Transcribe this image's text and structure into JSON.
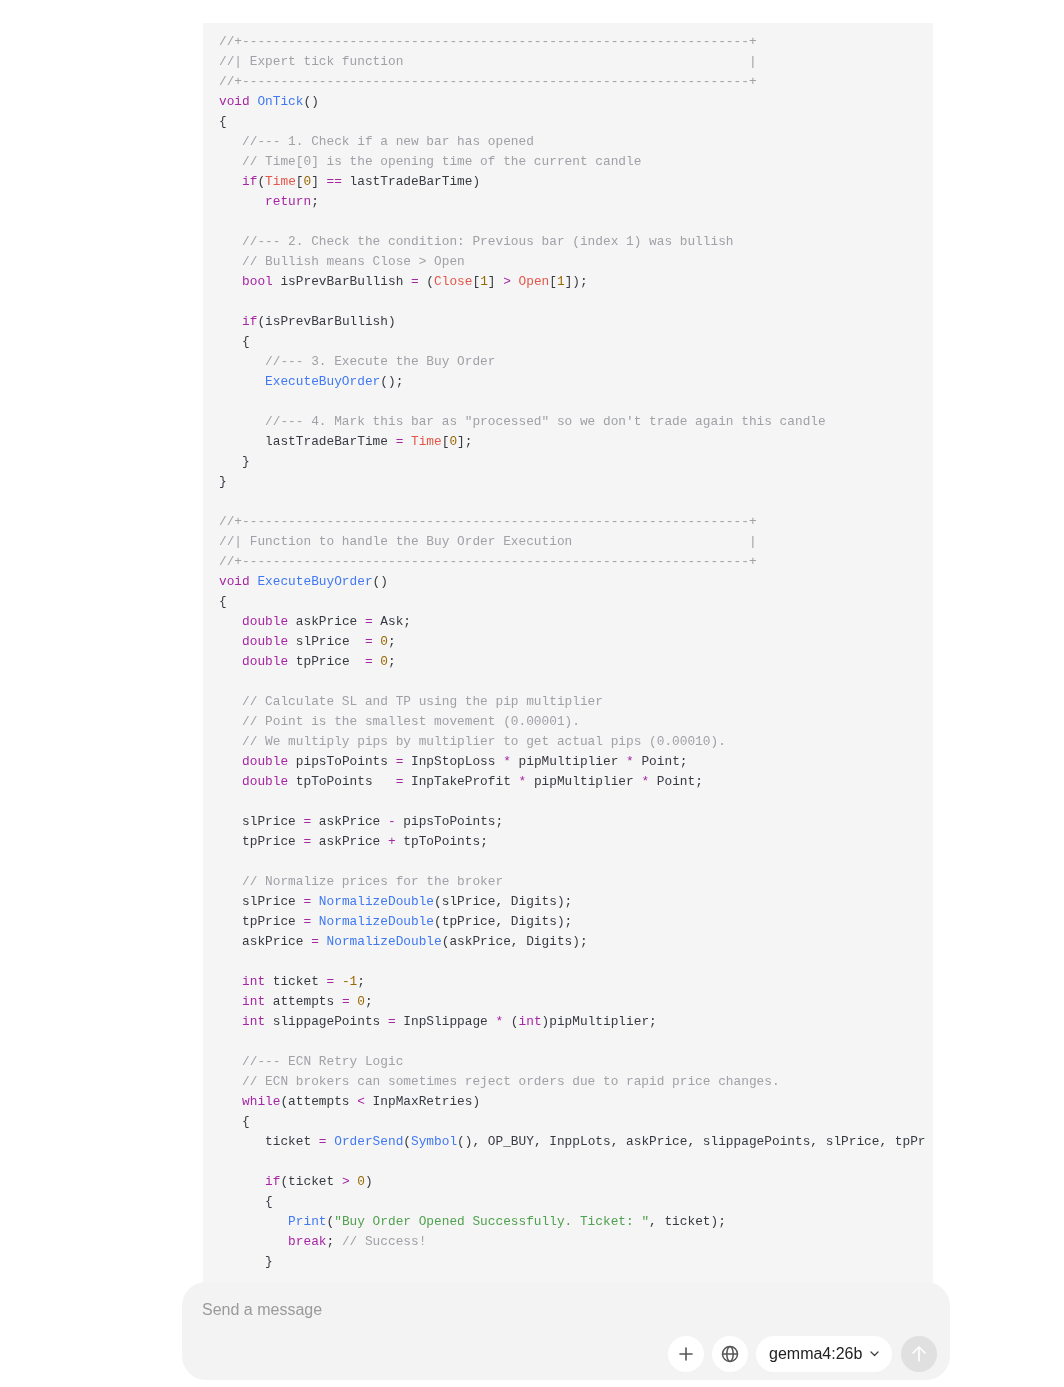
{
  "code_block": {
    "paragraphs": [
      [
        [
          {
            "kind": "comment",
            "text": "//+------------------------------------------------------------------+"
          }
        ],
        [
          {
            "kind": "comment",
            "text": "//| Expert tick function                                             |"
          }
        ],
        [
          {
            "kind": "comment",
            "text": "//+------------------------------------------------------------------+"
          }
        ],
        [
          {
            "kind": "keyword",
            "text": "void"
          },
          {
            "kind": "function",
            "text": " OnTick"
          },
          {
            "kind": "plain",
            "text": "()"
          }
        ],
        [
          {
            "kind": "plain",
            "text": "{"
          }
        ],
        [
          {
            "kind": "comment",
            "text": "   //--- 1. Check if a new bar has opened"
          }
        ],
        [
          {
            "kind": "comment",
            "text": "   // Time[0] is the opening time of the current candle"
          }
        ],
        [
          {
            "kind": "keyword",
            "text": "   if"
          },
          {
            "kind": "plain",
            "text": "("
          },
          {
            "kind": "builtin",
            "text": "Time"
          },
          {
            "kind": "plain",
            "text": "["
          },
          {
            "kind": "number",
            "text": "0"
          },
          {
            "kind": "plain",
            "text": "] "
          },
          {
            "kind": "operator",
            "text": "=="
          },
          {
            "kind": "plain",
            "text": " lastTradeBarTime)"
          }
        ],
        [
          {
            "kind": "keyword",
            "text": "      return"
          },
          {
            "kind": "plain",
            "text": ";"
          }
        ]
      ],
      [
        [
          {
            "kind": "comment",
            "text": "   //--- 2. Check the condition: Previous bar (index 1) was bullish"
          }
        ],
        [
          {
            "kind": "comment",
            "text": "   // Bullish means Close > Open"
          }
        ],
        [
          {
            "kind": "keyword",
            "text": "   bool"
          },
          {
            "kind": "plain",
            "text": " isPrevBarBullish "
          },
          {
            "kind": "operator",
            "text": "="
          },
          {
            "kind": "plain",
            "text": " ("
          },
          {
            "kind": "builtin",
            "text": "Close"
          },
          {
            "kind": "plain",
            "text": "["
          },
          {
            "kind": "number",
            "text": "1"
          },
          {
            "kind": "plain",
            "text": "] "
          },
          {
            "kind": "operator",
            "text": ">"
          },
          {
            "kind": "builtin",
            "text": " Open"
          },
          {
            "kind": "plain",
            "text": "["
          },
          {
            "kind": "number",
            "text": "1"
          },
          {
            "kind": "plain",
            "text": "]);"
          }
        ]
      ],
      [
        [
          {
            "kind": "keyword",
            "text": "   if"
          },
          {
            "kind": "plain",
            "text": "(isPrevBarBullish)"
          }
        ],
        [
          {
            "kind": "plain",
            "text": "   {"
          }
        ],
        [
          {
            "kind": "comment",
            "text": "      //--- 3. Execute the Buy Order"
          }
        ],
        [
          {
            "kind": "function",
            "text": "      ExecuteBuyOrder"
          },
          {
            "kind": "plain",
            "text": "();"
          }
        ]
      ],
      [
        [
          {
            "kind": "comment",
            "text": "      //--- 4. Mark this bar as \"processed\" so we don't trade again this candle"
          }
        ],
        [
          {
            "kind": "plain",
            "text": "      lastTradeBarTime "
          },
          {
            "kind": "operator",
            "text": "="
          },
          {
            "kind": "builtin",
            "text": " Time"
          },
          {
            "kind": "plain",
            "text": "["
          },
          {
            "kind": "number",
            "text": "0"
          },
          {
            "kind": "plain",
            "text": "];"
          }
        ],
        [
          {
            "kind": "plain",
            "text": "   }"
          }
        ],
        [
          {
            "kind": "plain",
            "text": "}"
          }
        ]
      ],
      [
        [
          {
            "kind": "comment",
            "text": "//+------------------------------------------------------------------+"
          }
        ],
        [
          {
            "kind": "comment",
            "text": "//| Function to handle the Buy Order Execution                       |"
          }
        ],
        [
          {
            "kind": "comment",
            "text": "//+------------------------------------------------------------------+"
          }
        ],
        [
          {
            "kind": "keyword",
            "text": "void"
          },
          {
            "kind": "function",
            "text": " ExecuteBuyOrder"
          },
          {
            "kind": "plain",
            "text": "()"
          }
        ],
        [
          {
            "kind": "plain",
            "text": "{"
          }
        ],
        [
          {
            "kind": "keyword",
            "text": "   double"
          },
          {
            "kind": "plain",
            "text": " askPrice "
          },
          {
            "kind": "operator",
            "text": "="
          },
          {
            "kind": "plain",
            "text": " Ask;"
          }
        ],
        [
          {
            "kind": "keyword",
            "text": "   double"
          },
          {
            "kind": "plain",
            "text": " slPrice  "
          },
          {
            "kind": "operator",
            "text": "="
          },
          {
            "kind": "number",
            "text": " 0"
          },
          {
            "kind": "plain",
            "text": ";"
          }
        ],
        [
          {
            "kind": "keyword",
            "text": "   double"
          },
          {
            "kind": "plain",
            "text": " tpPrice  "
          },
          {
            "kind": "operator",
            "text": "="
          },
          {
            "kind": "number",
            "text": " 0"
          },
          {
            "kind": "plain",
            "text": ";"
          }
        ]
      ],
      [
        [
          {
            "kind": "comment",
            "text": "   // Calculate SL and TP using the pip multiplier"
          }
        ],
        [
          {
            "kind": "comment",
            "text": "   // Point is the smallest movement (0.00001)."
          }
        ],
        [
          {
            "kind": "comment",
            "text": "   // We multiply pips by multiplier to get actual pips (0.00010)."
          }
        ],
        [
          {
            "kind": "keyword",
            "text": "   double"
          },
          {
            "kind": "plain",
            "text": " pipsToPoints "
          },
          {
            "kind": "operator",
            "text": "="
          },
          {
            "kind": "plain",
            "text": " InpStopLoss "
          },
          {
            "kind": "operator",
            "text": "*"
          },
          {
            "kind": "plain",
            "text": " pipMultiplier "
          },
          {
            "kind": "operator",
            "text": "*"
          },
          {
            "kind": "plain",
            "text": " Point;"
          }
        ],
        [
          {
            "kind": "keyword",
            "text": "   double"
          },
          {
            "kind": "plain",
            "text": " tpToPoints   "
          },
          {
            "kind": "operator",
            "text": "="
          },
          {
            "kind": "plain",
            "text": " InpTakeProfit "
          },
          {
            "kind": "operator",
            "text": "*"
          },
          {
            "kind": "plain",
            "text": " pipMultiplier "
          },
          {
            "kind": "operator",
            "text": "*"
          },
          {
            "kind": "plain",
            "text": " Point;"
          }
        ]
      ],
      [
        [
          {
            "kind": "plain",
            "text": "   slPrice "
          },
          {
            "kind": "operator",
            "text": "="
          },
          {
            "kind": "plain",
            "text": " askPrice "
          },
          {
            "kind": "operator",
            "text": "-"
          },
          {
            "kind": "plain",
            "text": " pipsToPoints;"
          }
        ],
        [
          {
            "kind": "plain",
            "text": "   tpPrice "
          },
          {
            "kind": "operator",
            "text": "="
          },
          {
            "kind": "plain",
            "text": " askPrice "
          },
          {
            "kind": "operator",
            "text": "+"
          },
          {
            "kind": "plain",
            "text": " tpToPoints;"
          }
        ]
      ],
      [
        [
          {
            "kind": "comment",
            "text": "   // Normalize prices for the broker"
          }
        ],
        [
          {
            "kind": "plain",
            "text": "   slPrice "
          },
          {
            "kind": "operator",
            "text": "="
          },
          {
            "kind": "function",
            "text": " NormalizeDouble"
          },
          {
            "kind": "plain",
            "text": "(slPrice, Digits);"
          }
        ],
        [
          {
            "kind": "plain",
            "text": "   tpPrice "
          },
          {
            "kind": "operator",
            "text": "="
          },
          {
            "kind": "function",
            "text": " NormalizeDouble"
          },
          {
            "kind": "plain",
            "text": "(tpPrice, Digits);"
          }
        ],
        [
          {
            "kind": "plain",
            "text": "   askPrice "
          },
          {
            "kind": "operator",
            "text": "="
          },
          {
            "kind": "function",
            "text": " NormalizeDouble"
          },
          {
            "kind": "plain",
            "text": "(askPrice, Digits);"
          }
        ]
      ],
      [
        [
          {
            "kind": "keyword",
            "text": "   int"
          },
          {
            "kind": "plain",
            "text": " ticket "
          },
          {
            "kind": "operator",
            "text": "="
          },
          {
            "kind": "number",
            "text": " -1"
          },
          {
            "kind": "plain",
            "text": ";"
          }
        ],
        [
          {
            "kind": "keyword",
            "text": "   int"
          },
          {
            "kind": "plain",
            "text": " attempts "
          },
          {
            "kind": "operator",
            "text": "="
          },
          {
            "kind": "number",
            "text": " 0"
          },
          {
            "kind": "plain",
            "text": ";"
          }
        ],
        [
          {
            "kind": "keyword",
            "text": "   int"
          },
          {
            "kind": "plain",
            "text": " slippagePoints "
          },
          {
            "kind": "operator",
            "text": "="
          },
          {
            "kind": "plain",
            "text": " InpSlippage "
          },
          {
            "kind": "operator",
            "text": "*"
          },
          {
            "kind": "plain",
            "text": " ("
          },
          {
            "kind": "keyword",
            "text": "int"
          },
          {
            "kind": "plain",
            "text": ")pipMultiplier;"
          }
        ]
      ],
      [
        [
          {
            "kind": "comment",
            "text": "   //--- ECN Retry Logic"
          }
        ],
        [
          {
            "kind": "comment",
            "text": "   // ECN brokers can sometimes reject orders due to rapid price changes."
          }
        ],
        [
          {
            "kind": "keyword",
            "text": "   while"
          },
          {
            "kind": "plain",
            "text": "(attempts "
          },
          {
            "kind": "operator",
            "text": "<"
          },
          {
            "kind": "plain",
            "text": " InpMaxRetries)"
          }
        ],
        [
          {
            "kind": "plain",
            "text": "   {"
          }
        ],
        [
          {
            "kind": "plain",
            "text": "      ticket "
          },
          {
            "kind": "operator",
            "text": "="
          },
          {
            "kind": "function",
            "text": " OrderSend"
          },
          {
            "kind": "plain",
            "text": "("
          },
          {
            "kind": "function",
            "text": "Symbol"
          },
          {
            "kind": "plain",
            "text": "(), OP_BUY, InppLots, askPrice, slippagePoints, slPrice, tpPr"
          }
        ]
      ],
      [
        [
          {
            "kind": "keyword",
            "text": "      if"
          },
          {
            "kind": "plain",
            "text": "(ticket "
          },
          {
            "kind": "operator",
            "text": ">"
          },
          {
            "kind": "number",
            "text": " 0"
          },
          {
            "kind": "plain",
            "text": ")"
          }
        ],
        [
          {
            "kind": "plain",
            "text": "      {"
          }
        ],
        [
          {
            "kind": "function",
            "text": "         Print"
          },
          {
            "kind": "plain",
            "text": "("
          },
          {
            "kind": "string",
            "text": "\"Buy Order Opened Successfully. Ticket: \""
          },
          {
            "kind": "plain",
            "text": ", ticket);"
          }
        ],
        [
          {
            "kind": "keyword",
            "text": "         break"
          },
          {
            "kind": "plain",
            "text": ";"
          },
          {
            "kind": "comment",
            "text": " // Success!"
          }
        ],
        [
          {
            "kind": "plain",
            "text": "      }"
          }
        ]
      ]
    ]
  },
  "composer": {
    "placeholder": "Send a message",
    "model": "gemma4:26b"
  }
}
